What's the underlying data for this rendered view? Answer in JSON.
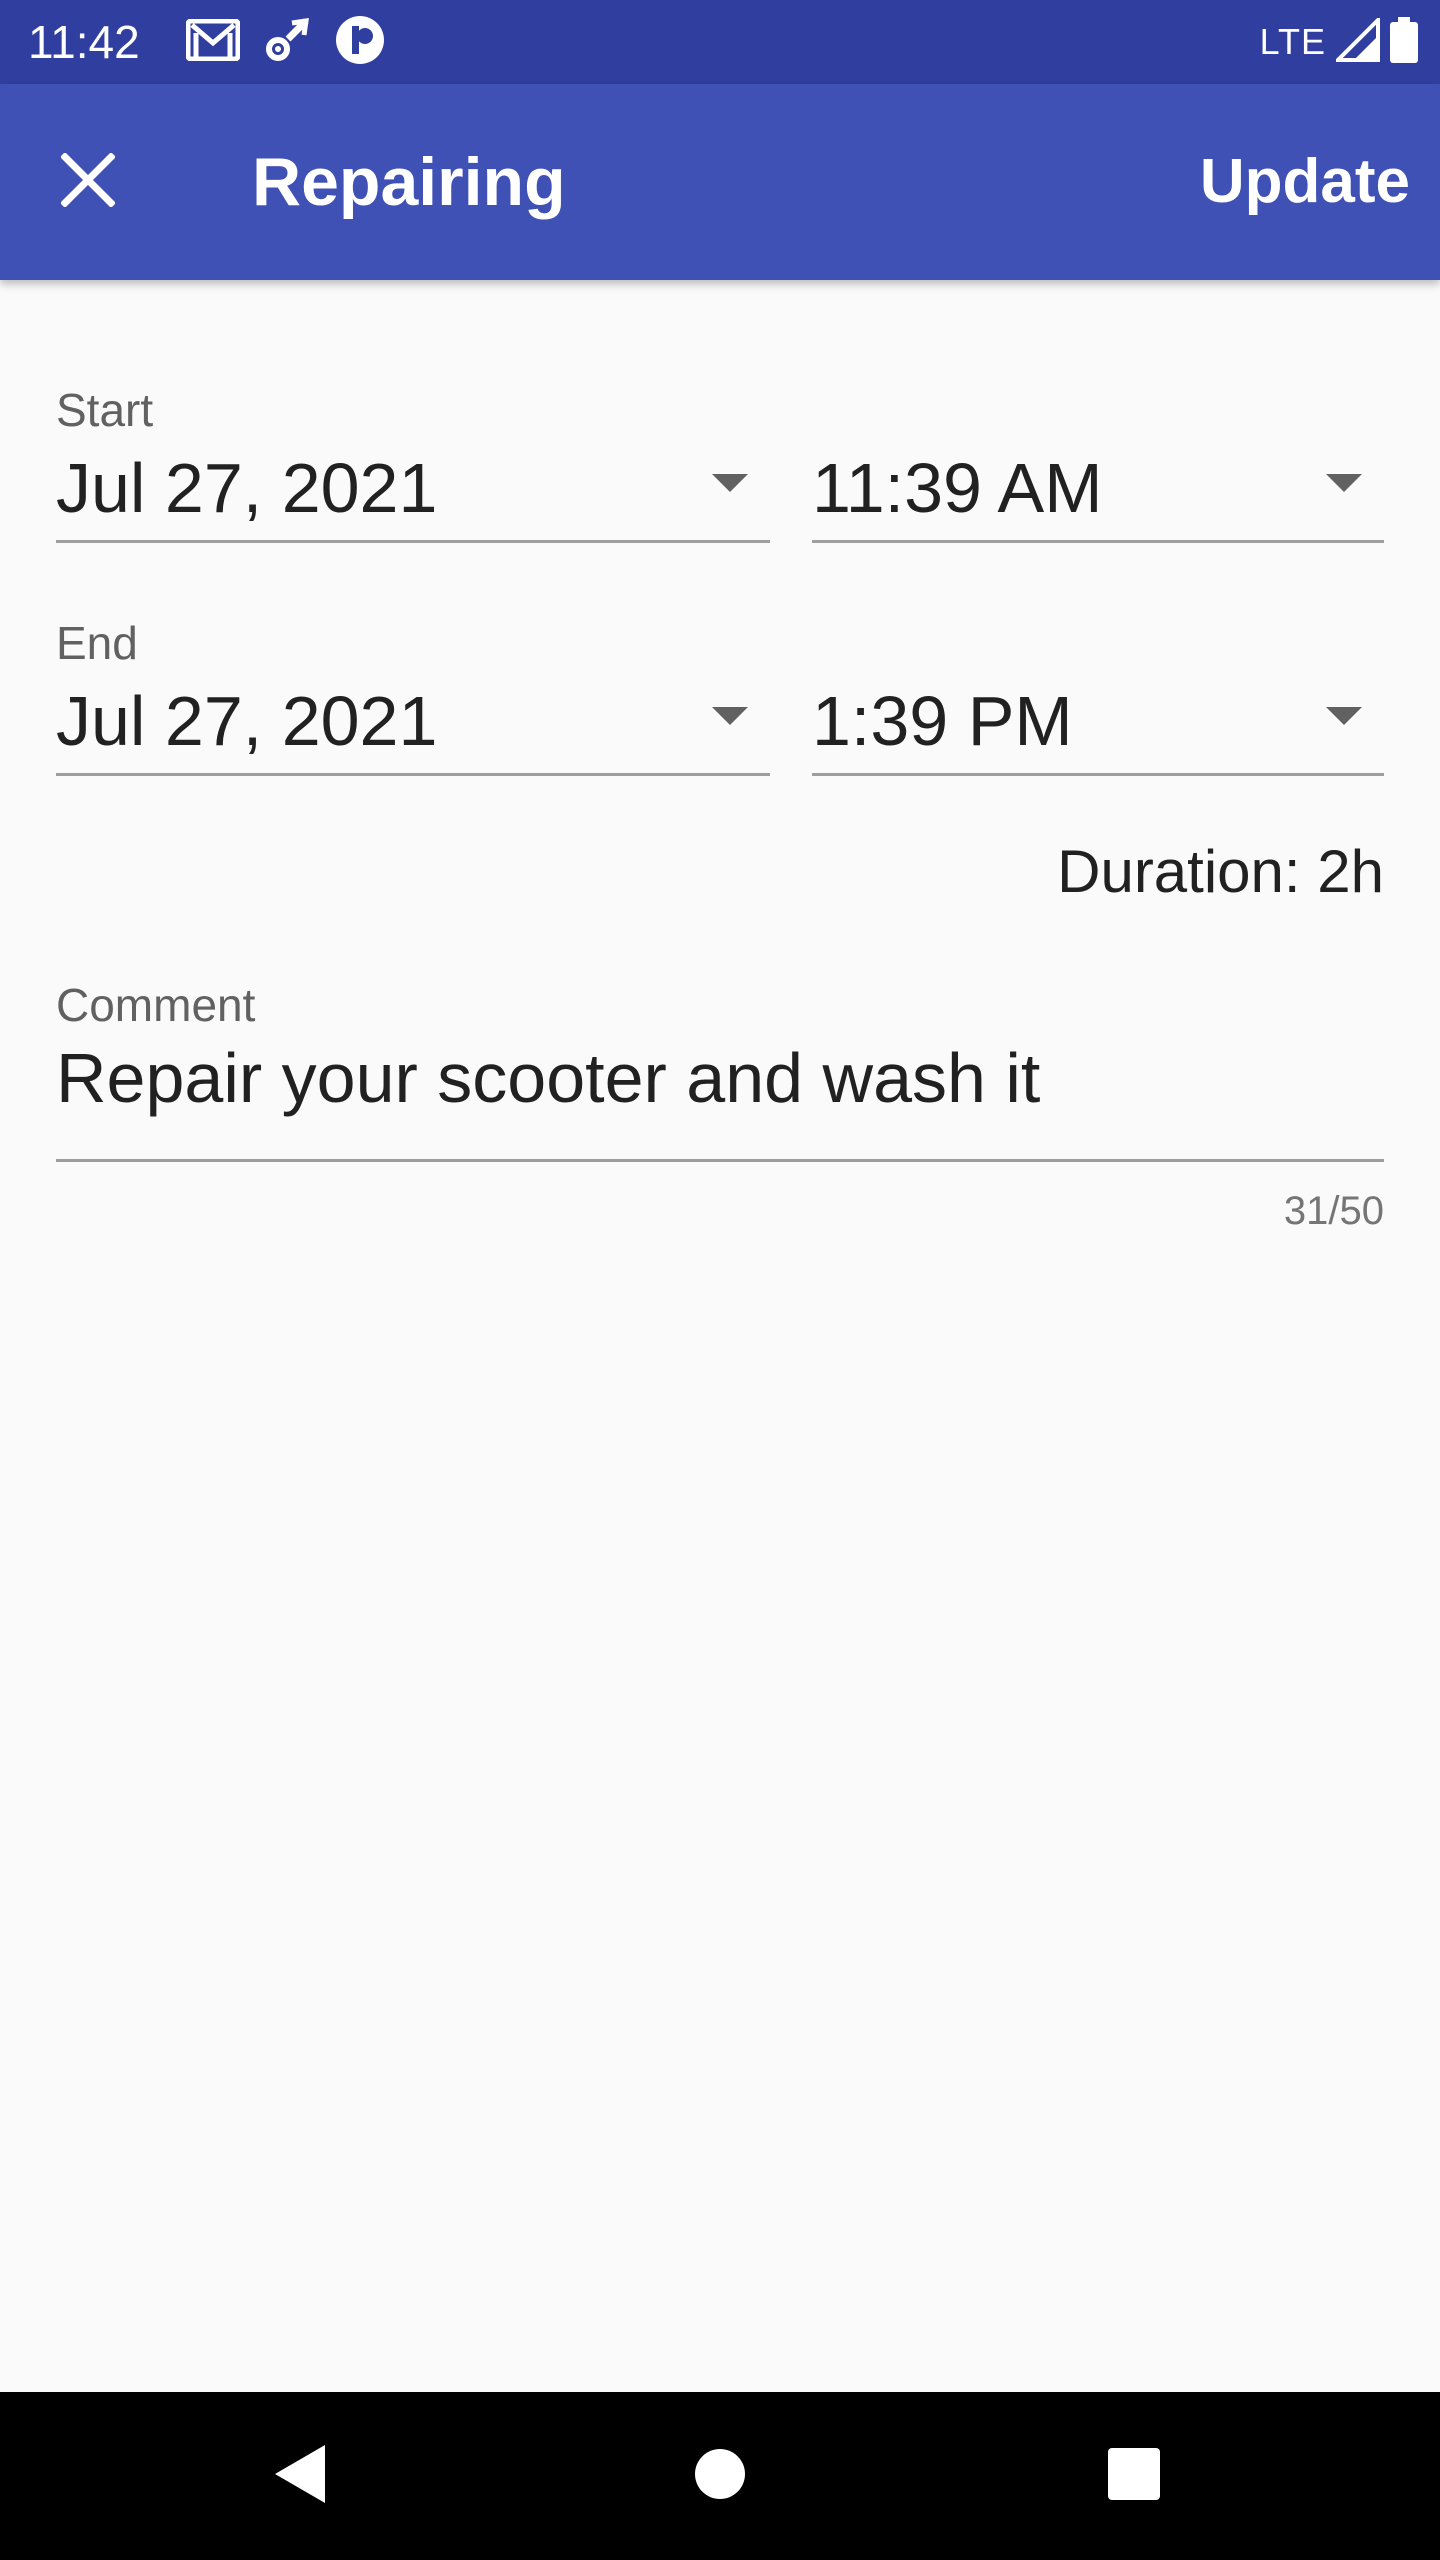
{
  "status_bar": {
    "time": "11:42",
    "network": "LTE",
    "icons": [
      "gmail-icon",
      "settings-sync-icon",
      "app-badge-icon",
      "signal-icon",
      "battery-icon"
    ]
  },
  "app_bar": {
    "close_icon": "close-icon",
    "title": "Repairing",
    "action_label": "Update",
    "color": "#3f51b5"
  },
  "form": {
    "start": {
      "label": "Start",
      "date": "Jul 27, 2021",
      "time": "11:39 AM"
    },
    "end": {
      "label": "End",
      "date": "Jul 27, 2021",
      "time": "1:39 PM"
    },
    "duration": "Duration: 2h",
    "comment": {
      "label": "Comment",
      "value": "Repair your scooter and wash it",
      "counter": "31/50"
    }
  },
  "nav_bar": {
    "icons": [
      "back-icon",
      "home-icon",
      "recents-icon"
    ]
  }
}
